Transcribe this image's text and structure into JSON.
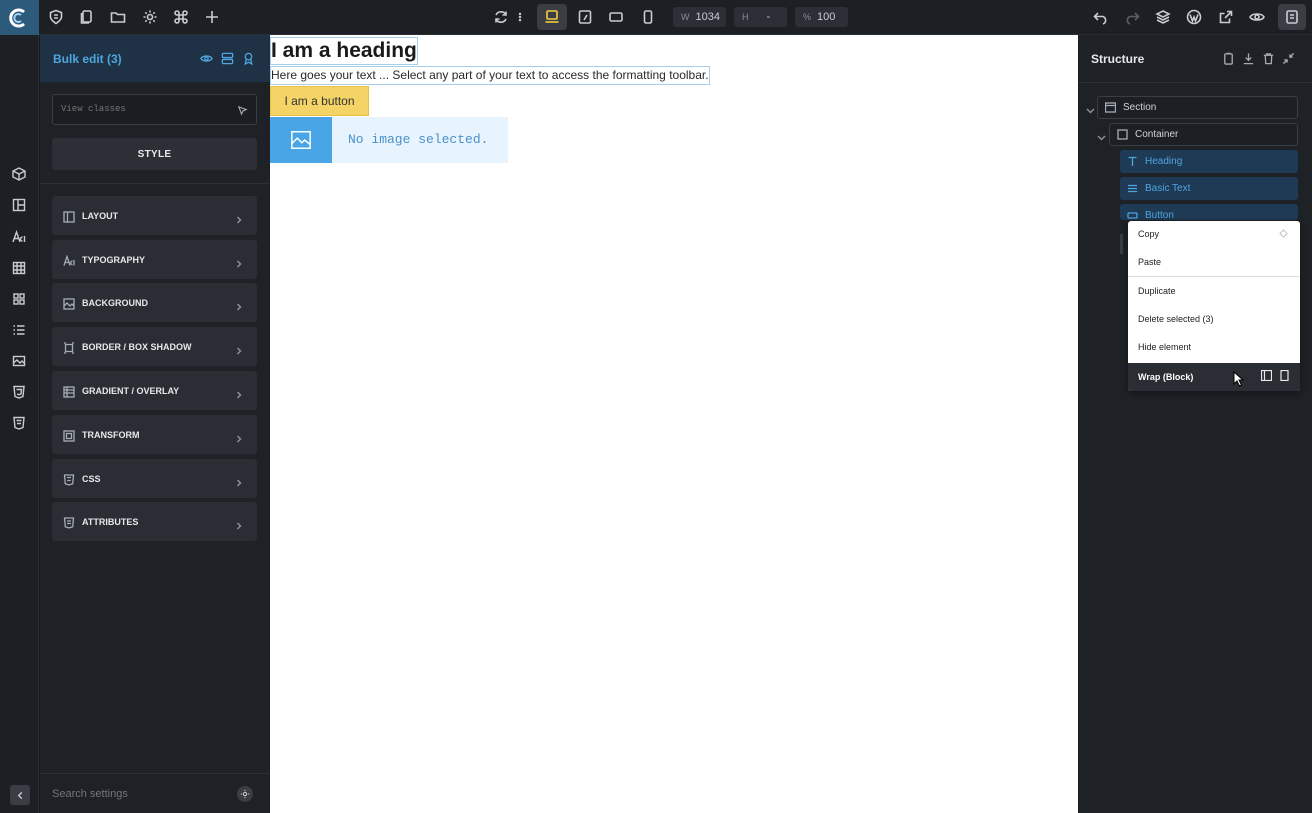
{
  "topbar": {
    "width_label": "W",
    "width_value": "1034",
    "height_label": "H",
    "height_value": "-",
    "zoom_label": "%",
    "zoom_value": "100"
  },
  "left_panel": {
    "title": "Bulk edit (3)",
    "classes_placeholder": "View classes",
    "style_button": "STYLE",
    "sections": [
      {
        "label": "LAYOUT",
        "icon": "layout-icon"
      },
      {
        "label": "TYPOGRAPHY",
        "icon": "typography-icon"
      },
      {
        "label": "BACKGROUND",
        "icon": "background-icon"
      },
      {
        "label": "BORDER / BOX SHADOW",
        "icon": "border-icon"
      },
      {
        "label": "GRADIENT / OVERLAY",
        "icon": "gradient-icon"
      },
      {
        "label": "TRANSFORM",
        "icon": "transform-icon"
      },
      {
        "label": "CSS",
        "icon": "css-icon"
      },
      {
        "label": "ATTRIBUTES",
        "icon": "attributes-icon"
      }
    ],
    "search_placeholder": "Search settings"
  },
  "canvas": {
    "heading": "I am a heading",
    "basic_text": "Here goes your text ... Select any part of your text to access the formatting toolbar.",
    "button": "I am a button",
    "image_placeholder": "No image selected."
  },
  "structure": {
    "title": "Structure",
    "nodes": [
      {
        "label": "Section"
      },
      {
        "label": "Container"
      },
      {
        "label": "Heading"
      },
      {
        "label": "Basic Text"
      },
      {
        "label": "Button"
      }
    ]
  },
  "context_menu": {
    "items": [
      "Copy",
      "Paste",
      "Duplicate",
      "Delete selected (3)",
      "Hide element"
    ],
    "wrap_label": "Wrap (Block)"
  },
  "colors": {
    "accent": "#4ea5df",
    "button_bg": "#f4d467",
    "panel_bg": "#1e2126"
  }
}
